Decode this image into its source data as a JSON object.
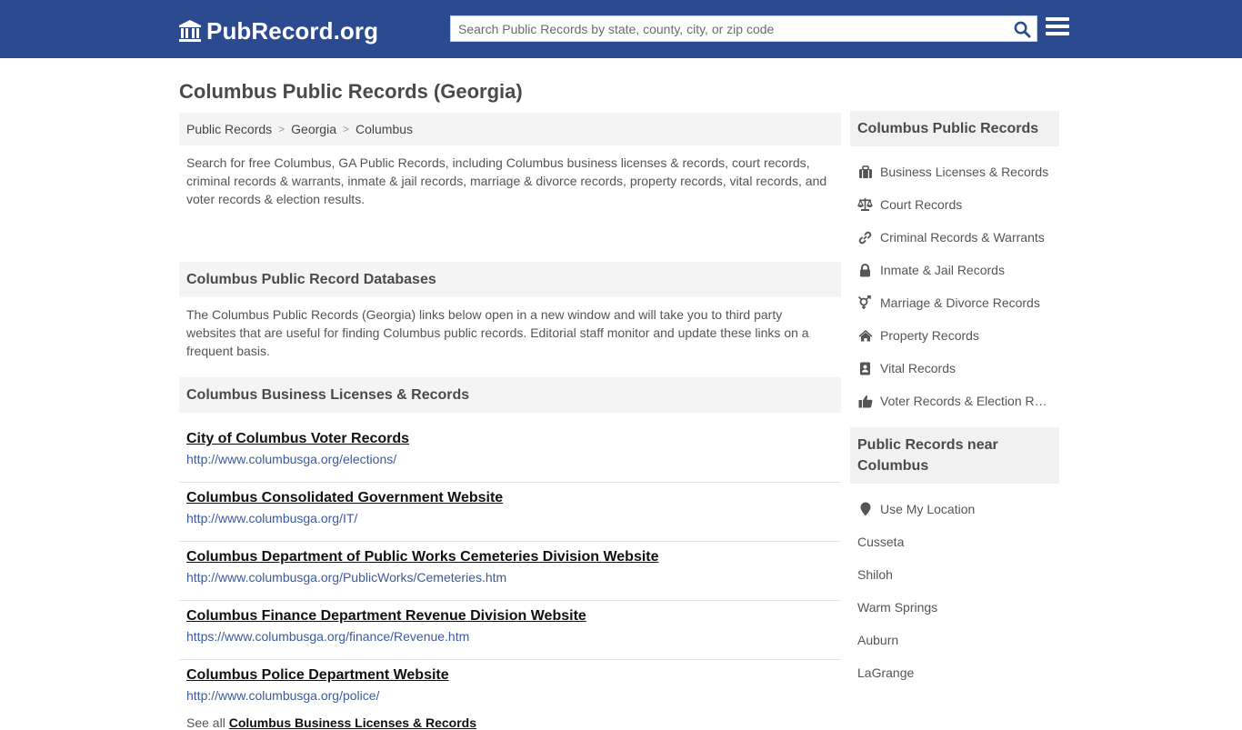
{
  "header": {
    "logo_text": "PubRecord.org",
    "search_placeholder": "Search Public Records by state, county, city, or zip code"
  },
  "page_title": "Columbus Public Records (Georgia)",
  "breadcrumb": [
    "Public Records",
    "Georgia",
    "Columbus"
  ],
  "intro": "Search for free Columbus, GA Public Records, including Columbus business licenses & records, court records, criminal records & warrants, inmate & jail records, marriage & divorce records, property records, vital records, and voter records & election results.",
  "databases": {
    "heading": "Columbus Public Record Databases",
    "note": "The Columbus Public Records (Georgia) links below open in a new window and will take you to third party websites that are useful for finding Columbus public records. Editorial staff monitor and update these links on a frequent basis."
  },
  "business": {
    "heading": "Columbus Business Licenses & Records",
    "links": [
      {
        "title": "City of Columbus Voter Records",
        "url": "http://www.columbusga.org/elections/"
      },
      {
        "title": "Columbus Consolidated Government Website",
        "url": "http://www.columbusga.org/IT/"
      },
      {
        "title": "Columbus Department of Public Works Cemeteries Division Website",
        "url": "http://www.columbusga.org/PublicWorks/Cemeteries.htm"
      },
      {
        "title": "Columbus Finance Department Revenue Division Website",
        "url": "https://www.columbusga.org/finance/Revenue.htm"
      },
      {
        "title": "Columbus Police Department Website",
        "url": "http://www.columbusga.org/police/"
      }
    ],
    "see_all_prefix": "See all",
    "see_all_link": "Columbus Business Licenses & Records"
  },
  "sidebar": {
    "records_heading": "Columbus Public Records",
    "records": [
      {
        "label": "Business Licenses & Records",
        "icon": "briefcase-icon"
      },
      {
        "label": "Court Records",
        "icon": "scale-icon"
      },
      {
        "label": "Criminal Records & Warrants",
        "icon": "link-icon"
      },
      {
        "label": "Inmate & Jail Records",
        "icon": "lock-icon"
      },
      {
        "label": "Marriage & Divorce Records",
        "icon": "gender-icon"
      },
      {
        "label": "Property Records",
        "icon": "home-icon"
      },
      {
        "label": "Vital Records",
        "icon": "address-book-icon"
      },
      {
        "label": "Voter Records & Election Results",
        "icon": "thumbs-up-icon"
      }
    ],
    "near_heading": "Public Records near Columbus",
    "use_location": "Use My Location",
    "nearby": [
      "Cusseta",
      "Shiloh",
      "Warm Springs",
      "Auburn",
      "LaGrange"
    ]
  },
  "colors": {
    "header_bg": "#2b4a8f",
    "link_url": "#3a5ba0",
    "panel_bg": "#f4f4f4"
  }
}
